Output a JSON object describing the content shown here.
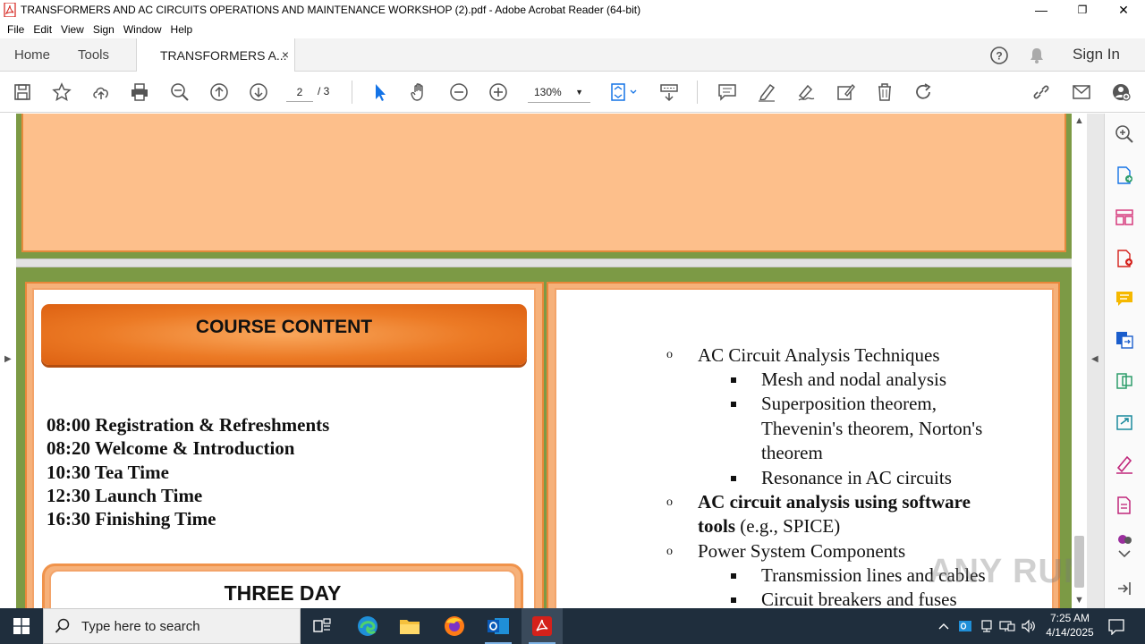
{
  "window": {
    "title": "TRANSFORMERS AND AC CIRCUITS OPERATIONS AND MAINTENANCE WORKSHOP (2).pdf - Adobe Acrobat Reader (64-bit)",
    "minimize": "—",
    "restore": "❐",
    "close": "✕"
  },
  "menu": [
    "File",
    "Edit",
    "View",
    "Sign",
    "Window",
    "Help"
  ],
  "tabs": {
    "home": "Home",
    "tools": "Tools",
    "document": "TRANSFORMERS A...",
    "close": "×",
    "sign_in": "Sign In"
  },
  "toolbar": {
    "page_current": "2",
    "page_total": "/ 3",
    "zoom": "130%",
    "zoom_caret": "▼"
  },
  "document": {
    "left_column": {
      "banner": "COURSE CONTENT",
      "schedule": [
        "08:00 Registration & Refreshments",
        "08:20 Welcome & Introduction",
        "10:30 Tea Time",
        "12:30 Launch Time",
        "16:30 Finishing Time"
      ],
      "three_day": "THREE DAY"
    },
    "right_column": {
      "bullet_circle": "o",
      "item1": "AC Circuit Analysis Techniques",
      "item1_subs": [
        "Mesh and nodal analysis",
        "Superposition theorem,",
        "Thevenin's theorem, Norton's",
        "theorem",
        "Resonance in AC circuits"
      ],
      "item2_bold1": "AC circuit analysis using software",
      "item2_bold2": "tools",
      "item2_rest": " (e.g., SPICE)",
      "item3": "Power System Components",
      "item3_subs": [
        "Transmission lines and cables",
        "Circuit breakers and fuses"
      ]
    }
  },
  "watermark": "ANY  RUN",
  "taskbar": {
    "search_placeholder": "Type here to search",
    "time": "7:25 AM",
    "date": "4/14/2025"
  },
  "colors": {
    "page_green": "#7c9a45",
    "page_peach": "#fdbf8b",
    "banner_orange": "#ec7a25",
    "taskbar": "#1f2e3d",
    "acrobat_red": "#d4211b",
    "select_blue": "#1473e6"
  }
}
